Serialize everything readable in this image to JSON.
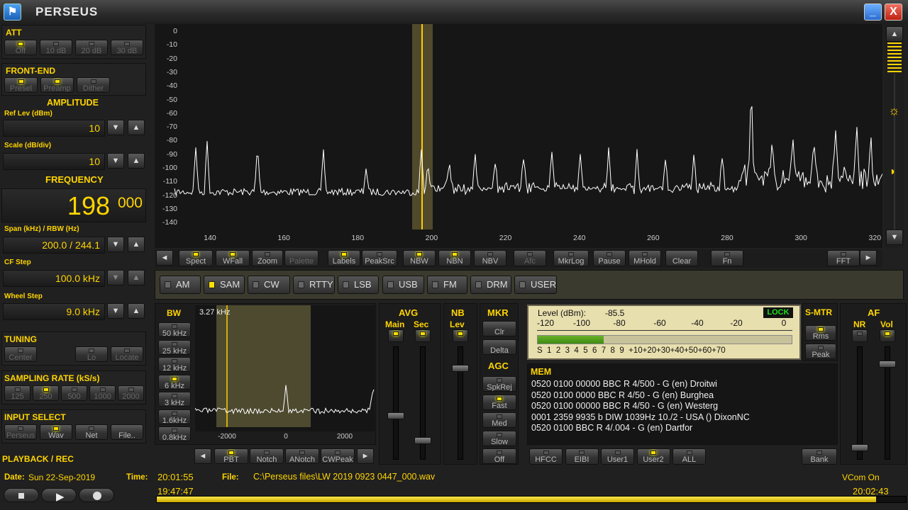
{
  "app": {
    "title": "PERSEUS",
    "icon": "perseus-logo-icon",
    "minimize": "_",
    "close": "X"
  },
  "left": {
    "att": {
      "title": "ATT",
      "buttons": [
        "Off",
        "10 dB",
        "20 dB",
        "30 dB"
      ],
      "active": 0
    },
    "frontend": {
      "title": "FRONT-END",
      "buttons": [
        "Presel",
        "Preamp",
        "Dither"
      ],
      "active": [
        0,
        1
      ]
    },
    "amplitude": {
      "title": "AMPLITUDE",
      "ref_label": "Ref Lev (dBm)",
      "ref_value": "10",
      "scale_label": "Scale (dB/div)",
      "scale_value": "10"
    },
    "frequency": {
      "title": "FREQUENCY",
      "main": "198",
      "sub": "000"
    },
    "span": {
      "label": "Span (kHz) / RBW (Hz)",
      "value": "200.0 / 244.1"
    },
    "cfstep": {
      "label": "CF Step",
      "value": "100.0 kHz"
    },
    "wheel": {
      "label": "Wheel Step",
      "value": "9.0 kHz"
    },
    "tuning": {
      "title": "TUNING",
      "buttons": [
        "Center",
        "Lo",
        "Locate"
      ]
    },
    "sampling": {
      "title": "SAMPLING RATE (kS/s)",
      "buttons": [
        "125",
        "250",
        "500",
        "1000",
        "2000"
      ],
      "active": 1
    },
    "input": {
      "title": "INPUT SELECT",
      "buttons": [
        "Perseus",
        "Wav",
        "Net",
        "File.."
      ],
      "active": 1
    },
    "playback": {
      "title": "PLAYBACK / REC"
    }
  },
  "spectrum": {
    "ylabels": [
      "0",
      "-10",
      "-20",
      "-30",
      "-40",
      "-50",
      "-60",
      "-70",
      "-80",
      "-90",
      "-100",
      "-110",
      "-120",
      "-130",
      "-140"
    ],
    "xlabels": [
      "140",
      "160",
      "180",
      "200",
      "220",
      "240",
      "260",
      "280",
      "300",
      "320"
    ],
    "cursor_khz": 198
  },
  "toolbar": {
    "left_arrow": "◄",
    "right_arrow": "►",
    "buttons": [
      {
        "label": "Spect",
        "led": true,
        "on": true
      },
      {
        "label": "WFall",
        "led": true,
        "on": true
      },
      {
        "label": "Zoom",
        "led": true,
        "on": false
      },
      {
        "label": "Palette",
        "led": false,
        "on": false
      },
      {
        "label": "Labels",
        "led": true,
        "on": true
      },
      {
        "label": "PeakSrc",
        "led": true,
        "on": false
      },
      {
        "label": "NBW",
        "led": true,
        "on": true
      },
      {
        "label": "NBN",
        "led": true,
        "on": true
      },
      {
        "label": "NBV",
        "led": true,
        "on": false
      },
      {
        "label": "Afc",
        "led": true,
        "on": false
      },
      {
        "label": "MkrLog",
        "led": true,
        "on": false
      },
      {
        "label": "Pause",
        "led": true,
        "on": false
      },
      {
        "label": "MHold",
        "led": true,
        "on": false
      },
      {
        "label": "Clear",
        "led": false,
        "on": false
      },
      {
        "label": "Fn",
        "led": true,
        "on": false
      },
      {
        "label": "FFT",
        "led": true,
        "on": false
      }
    ]
  },
  "modes": {
    "items": [
      "AM",
      "SAM",
      "CW",
      "RTTY",
      "LSB",
      "USB",
      "FM",
      "DRM",
      "USER"
    ],
    "active": 1
  },
  "bw": {
    "title": "BW",
    "readout": "3.27 kHz",
    "buttons": [
      "50 kHz",
      "25 kHz",
      "12 kHz",
      "6 kHz",
      "3 kHz",
      "1.6kHz",
      "0.8kHz"
    ],
    "active": 3,
    "xlabels": [
      "-2000",
      "0",
      "2000"
    ]
  },
  "bottom_toolbar": {
    "left": "◄",
    "right": "►",
    "buttons": [
      "PBT",
      "Notch",
      "ANotch",
      "CWPeak"
    ],
    "pbt_on": true
  },
  "avg": {
    "title": "AVG",
    "main": "Main",
    "sec": "Sec"
  },
  "nb": {
    "title": "NB",
    "lev": "Lev"
  },
  "mkr": {
    "title": "MKR",
    "clr": "Clr",
    "delta": "Delta"
  },
  "agc": {
    "title": "AGC",
    "buttons": [
      "SpkRej",
      "Fast",
      "Med",
      "Slow",
      "Off"
    ],
    "active": 1
  },
  "meter": {
    "level_label": "Level (dBm):",
    "level_value": "-85.5",
    "lock": "LOCK",
    "scale": [
      "-120",
      "-100",
      "-80",
      "-60",
      "-40",
      "-20",
      "0"
    ],
    "s_scale": "S  1  2  3  4  5  6  7  8  9  +10+20+30+40+50+60+70",
    "level_fraction": 0.26
  },
  "smtr": {
    "title": "S-MTR",
    "rms": "Rms",
    "peak": "Peak"
  },
  "af": {
    "title": "AF",
    "nr": "NR",
    "vol": "Vol"
  },
  "mem": {
    "title": "MEM",
    "lines": [
      "0520 0100 00000 BBC R 4/500  - G (en)  Droitwi",
      "0520 0100 0000 BBC R 4/50  - G (en)  Burghea",
      "0520 0100 00000 BBC R 4/50  - G (en)  Westerg",
      "0001 2359 9935 b DIW 1039Hz 10./2  - USA ()  DixonNC",
      "0520 0100 BBC R 4/.004  - G (en)  Dartfor"
    ],
    "buttons": [
      "HFCC",
      "EIBI",
      "User1",
      "User2",
      "ALL"
    ],
    "active": 3,
    "bank": "Bank"
  },
  "status": {
    "date_label": "Date:",
    "date": "Sun 22-Sep-2019",
    "time_label": "Time:",
    "time": "20:01:55",
    "file_label": "File:",
    "file": "C:\\Perseus files\\LW 2019 0923 0447_000.wav",
    "vcom": "VCom On",
    "start": "19:47:47",
    "end": "20:02:43",
    "progress": 0.96
  },
  "colors": {
    "accent": "#ffd500",
    "trace": "#ffffff",
    "cursor": "#ffcc00"
  }
}
